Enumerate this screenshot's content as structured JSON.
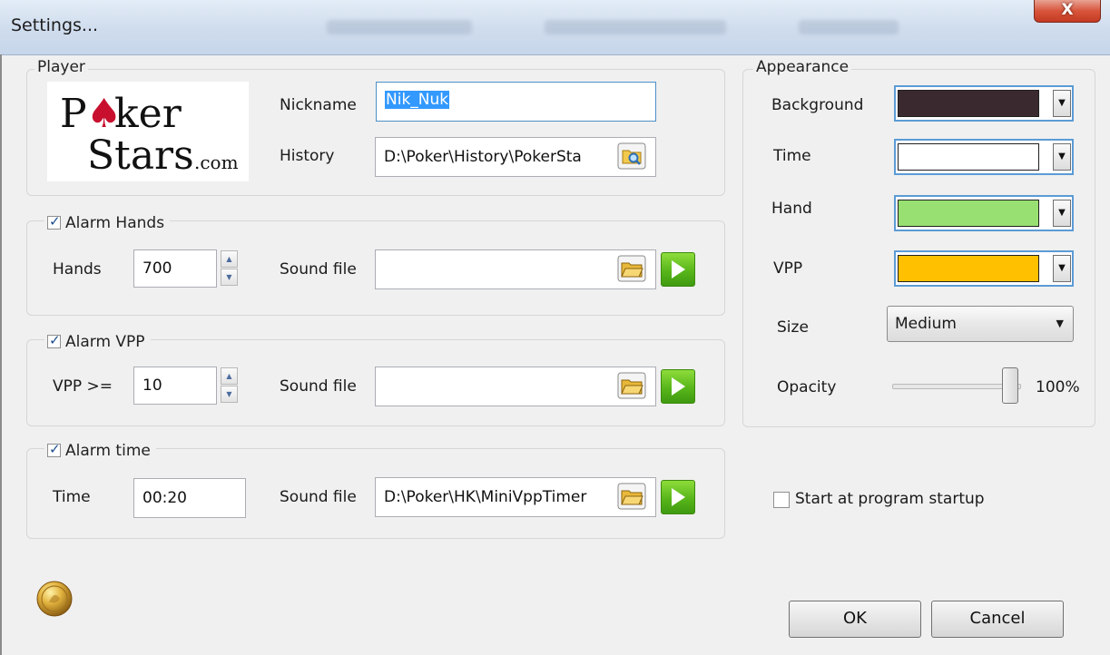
{
  "window": {
    "title": "Settings...",
    "close_label": "X"
  },
  "player": {
    "legend": "Player",
    "logo": {
      "line1": "Poker",
      "line2": "Stars",
      "suffix": ".com"
    },
    "nickname_label": "Nickname",
    "nickname_value": "Nik_Nuk",
    "history_label": "History",
    "history_value": "D:\\Poker\\History\\PokerSta"
  },
  "alarm_hands": {
    "legend": "Alarm Hands",
    "checked": true,
    "field_label": "Hands",
    "value": "700",
    "sound_label": "Sound file",
    "sound_value": ""
  },
  "alarm_vpp": {
    "legend": "Alarm VPP",
    "checked": true,
    "field_label": "VPP >=",
    "value": "10",
    "sound_label": "Sound file",
    "sound_value": ""
  },
  "alarm_time": {
    "legend": "Alarm time",
    "checked": true,
    "field_label": "Time",
    "value": "00:20",
    "sound_label": "Sound file",
    "sound_value": "D:\\Poker\\HK\\MiniVppTimer"
  },
  "appearance": {
    "legend": "Appearance",
    "background_label": "Background",
    "background_color": "#3a2a30",
    "time_label": "Time",
    "time_color": "#ffffff",
    "hand_label": "Hand",
    "hand_color": "#99e073",
    "vpp_label": "VPP",
    "vpp_color": "#ffc000",
    "size_label": "Size",
    "size_value": "Medium",
    "opacity_label": "Opacity",
    "opacity_value": "100%"
  },
  "startup": {
    "label": "Start at program startup",
    "checked": false
  },
  "buttons": {
    "ok": "OK",
    "cancel": "Cancel"
  },
  "icons": {
    "browse": "folder-browse-icon",
    "play": "play-icon",
    "coin": "gold-coin-icon",
    "dropdown": "chevron-down-icon"
  }
}
